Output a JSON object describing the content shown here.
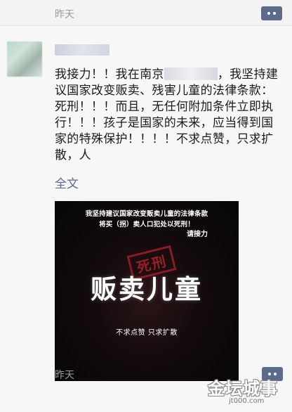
{
  "top_bar": {
    "timestamp": "昨天"
  },
  "post": {
    "text_before_redaction": "我接力！！我在南京",
    "text_after_redaction": "，我坚持建议国家改变贩卖、残害儿童的法律条款：死刑！！！而且，无任何附加条件立即执行！！！孩子是国家的未来，应当得到国家的特殊保护！！！！不求点赞，只求扩散，人",
    "full_text_link": "全文",
    "image": {
      "line1": "我坚持建议国家改变贩卖儿童的法律条款",
      "line2": "将买（拐）卖人口犯处以死刑！",
      "relay": "请接力",
      "stamp": "死刑",
      "headline": "贩卖儿童",
      "footer": "不求点赞    只求扩散"
    },
    "timestamp": "昨天"
  },
  "watermark": {
    "main": "金坛城事",
    "sub": "jt000.com"
  },
  "colors": {
    "link": "#576b95",
    "comment_button": "#5b6b8c",
    "stamp_red": "#b0212c"
  },
  "icons": {
    "comment": "comment-dots-icon"
  }
}
